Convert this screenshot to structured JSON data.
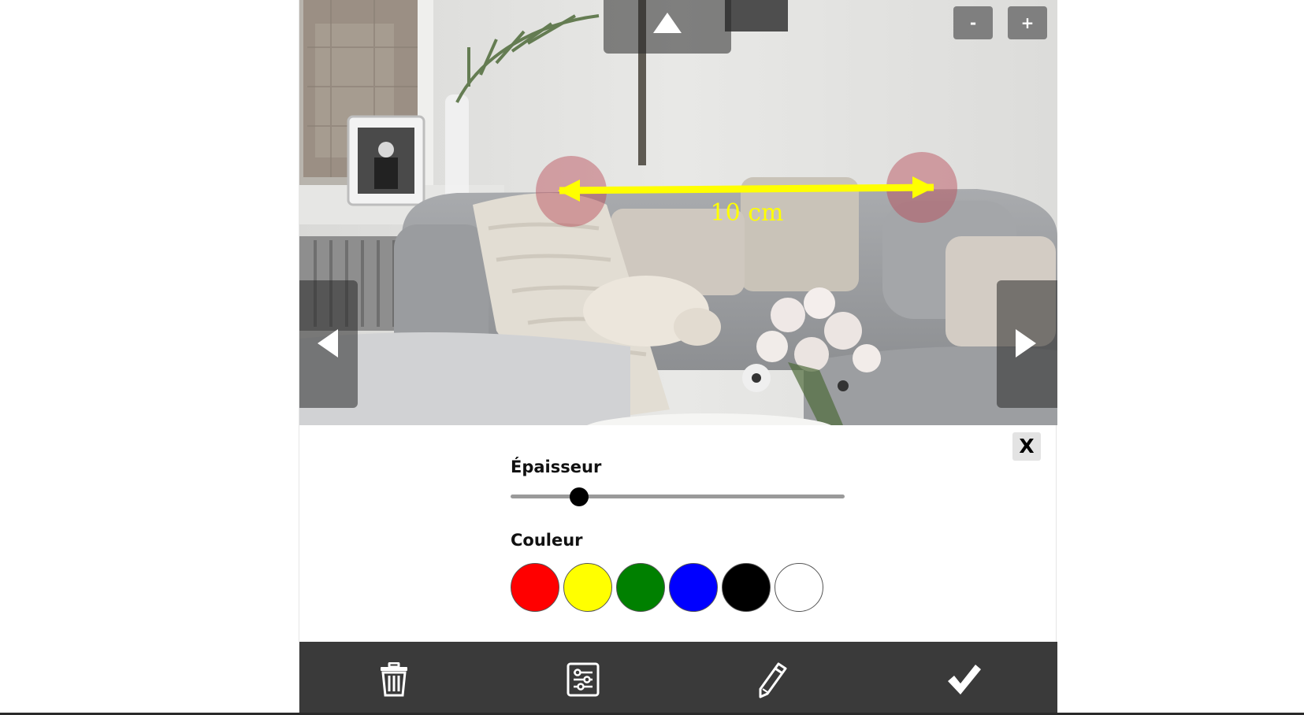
{
  "viewer": {
    "photo_icon": "living-room-photo",
    "zoom_out_label": "-",
    "zoom_in_label": "+",
    "measurement_label": "10 cm",
    "measurement_color": "#ffff00"
  },
  "panel": {
    "close_label": "X",
    "thickness_label": "Épaisseur",
    "thickness_value": 0.2,
    "color_label": "Couleur",
    "colors": [
      "#ff0000",
      "#ffff00",
      "#008000",
      "#0000ff",
      "#000000",
      "#ffffff"
    ],
    "selected_color": "#ffff00"
  },
  "toolbar": {
    "icons": [
      "trash-icon",
      "settings-sliders-icon",
      "pencil-icon",
      "checkmark-icon"
    ]
  }
}
